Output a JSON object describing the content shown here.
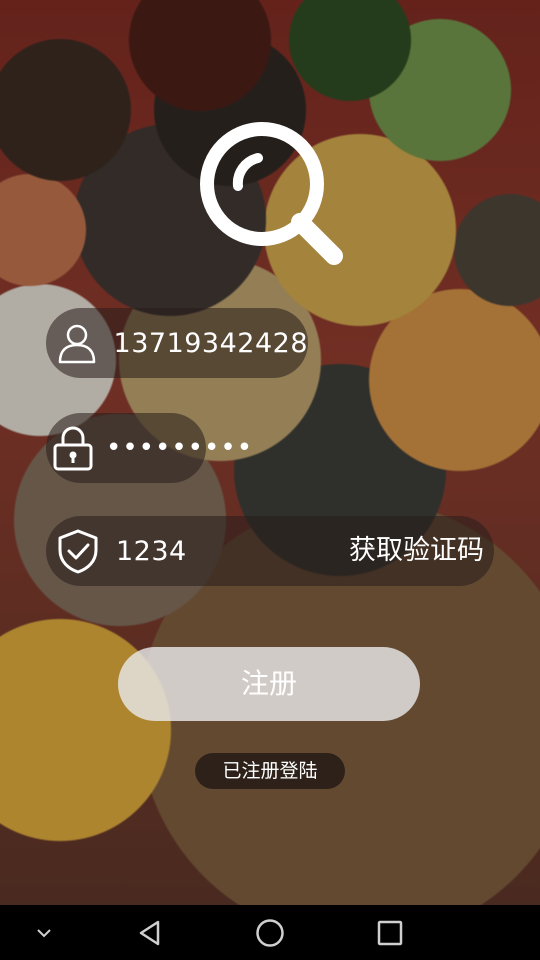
{
  "form": {
    "phone": {
      "value": "13719342428",
      "icon": "person-icon"
    },
    "password": {
      "value": "•••••••••",
      "icon": "lock-icon"
    },
    "code": {
      "value": "1234",
      "icon": "shield-check-icon",
      "button_label": "获取验证码"
    }
  },
  "actions": {
    "register_label": "注册",
    "login_link_label": "已注册登陆"
  },
  "logo": {
    "icon": "search-magnifier-icon"
  },
  "navbar": {
    "items": [
      "chevron-down-icon",
      "back-triangle-icon",
      "home-circle-icon",
      "recent-square-icon"
    ]
  },
  "colors": {
    "field_bg": "#281e1c",
    "button_bg": "#e8e8e8",
    "text": "#ffffff",
    "navbar": "#000000"
  }
}
